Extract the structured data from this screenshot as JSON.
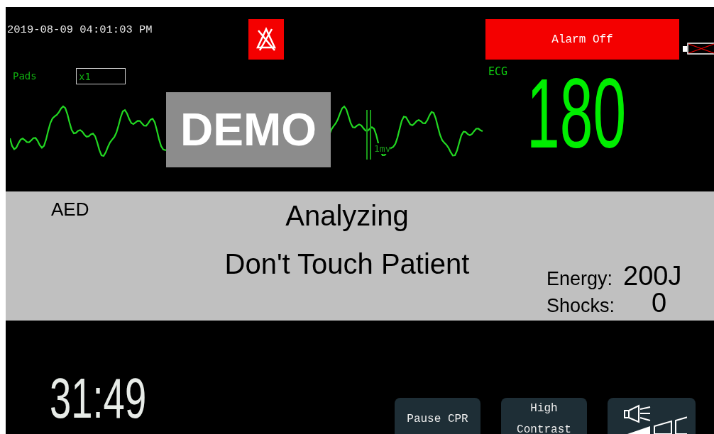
{
  "datetime": "2019-08-09 04:01:03 PM",
  "alarm_banner": {
    "label": "Alarm Off"
  },
  "pads": {
    "label": "Pads",
    "value": "x1"
  },
  "ecg": {
    "label": "ECG",
    "heart_rate": "180",
    "scale": "1mv",
    "demo_label": "DEMO"
  },
  "mode": "AED",
  "messages": [
    "Analyzing",
    "Don't Touch Patient"
  ],
  "energy": {
    "label": "Energy:",
    "value": "200J"
  },
  "shocks": {
    "label": "Shocks:",
    "value": "0"
  },
  "timer": "31:49",
  "buttons": [
    {
      "kind": "text",
      "label": "Pause CPR"
    },
    {
      "kind": "text",
      "label": "High Contrast"
    },
    {
      "kind": "volume"
    }
  ]
}
